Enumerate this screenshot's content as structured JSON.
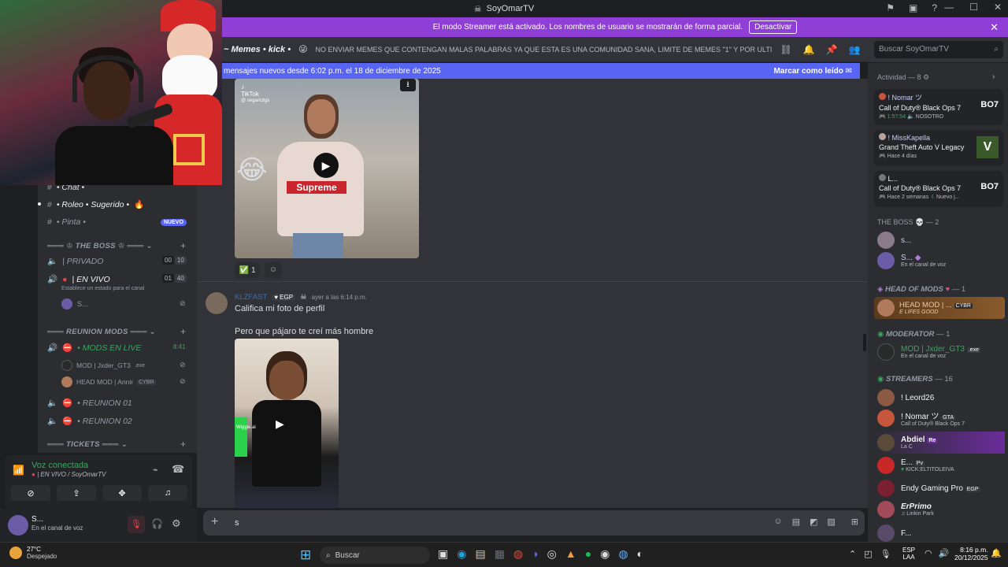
{
  "window": {
    "title": "SoyOmarTV"
  },
  "streamer_bar": {
    "text": "El modo Streamer está activado. Los nombres de usuario se mostrarán de forma parcial.",
    "button": "Desactivar"
  },
  "header": {
    "channel": "Memes • kick •",
    "topic": "NO ENVIAR MEMES QUE CONTENGAN MALAS PALABRAS YA QUE ESTA ES UNA COMUNIDAD SANA, LIMITE DE MEMES \"1\" Y POR ULTIMO E...",
    "search_placeholder": "Buscar SoyOmarTV"
  },
  "newbar": {
    "text": "mensajes nuevos desde 6:02 p.m. el 18 de diciembre de 2025",
    "mark_read": "Marcar como leído"
  },
  "messages": {
    "video_tiktok_label": "TikTok",
    "video_tiktok_user": "@ segaricitgs",
    "reaction_count": "1",
    "msg2": {
      "author": "KLZFAST",
      "tag": "EGP",
      "time": "ayer a las 6:14 p.m.",
      "line1": "Califica mi foto de perfil",
      "line2": "Pero que pájaro te creí más hombre"
    },
    "video2_watermark": "Wiggle.ai"
  },
  "input": {
    "value": "s"
  },
  "channels": {
    "items": [
      {
        "label": "• Chat •"
      },
      {
        "label": "• Roleo • Sugerido •"
      },
      {
        "label": "• Pinta •",
        "badge": "NUEVO"
      }
    ],
    "cat_boss": "THE BOSS",
    "privado": {
      "label": "| PRIVADO",
      "a": "00",
      "b": "10"
    },
    "envivo": {
      "label": "| EN VIVO",
      "a": "01",
      "b": "40",
      "status": "Establece un estado para el canal",
      "user": "S..."
    },
    "cat_reunion": "REUNION MODS",
    "mods_live": {
      "label": "• MODS EN LIVE",
      "time": "8:41"
    },
    "mod_user1": {
      "name": "MOD | Jxder_GT3",
      "tag": ".exe"
    },
    "mod_user2": {
      "name": "HEAD MOD | Annir",
      "tag": "CYBR"
    },
    "reunion01": "• REUNION 01",
    "reunion02": "• REUNION 02",
    "cat_tickets": "TICKETS"
  },
  "voice": {
    "status": "Voz conectada",
    "channel": "| EN VIVO / SoyOmarTV"
  },
  "userbar": {
    "name": "S...",
    "status": "En el canal de voz"
  },
  "members": {
    "activity_header": "Actividad — 8",
    "activities": [
      {
        "user": "! Nomar ツ",
        "game": "Call of Duty® Black Ops 7",
        "detail": "1:57:54",
        "detail2": "NOSOTRO",
        "logo": "BO7"
      },
      {
        "user": "! MissKapella",
        "game": "Grand Theft Auto V Legacy",
        "detail": "Hace 4 días",
        "detail2": "",
        "logo": "V"
      },
      {
        "user": "L...",
        "game": "Call of Duty® Black Ops 7",
        "detail": "Hace 2 semanas",
        "detail2": "Nuevo j...",
        "logo": "BO7"
      }
    ],
    "boss_header": "THE BOSS",
    "boss_count": "— 2",
    "boss_members": [
      {
        "name": "s...",
        "sub": ""
      },
      {
        "name": "S...",
        "sub": "En el canal de voz"
      }
    ],
    "headmods_header": "HEAD OF MODS",
    "headmods_count": "— 1",
    "headmod": {
      "name": "HEAD MOD | ...",
      "tag": "CYBR",
      "sub": "E LIFES GOOD"
    },
    "moderator_header": "MODERATOR",
    "moderator_count": "— 1",
    "moderator": {
      "name": "MOD | Jxder_GT3",
      "tag": ".exe",
      "sub": "En el canal de voz"
    },
    "streamers_header": "STREAMERS",
    "streamers_count": "— 16",
    "streamers": [
      {
        "name": "! Leord26",
        "tag": "",
        "sub": ""
      },
      {
        "name": "! Nomar ツ",
        "tag": "GTA",
        "sub": "Call of Duty® Black Ops 7"
      },
      {
        "name": "Abdiel",
        "tag": "Re",
        "sub": "La C"
      },
      {
        "name": "E...",
        "tag": "Pv",
        "sub": "KICK:ELTITOLEIVA"
      },
      {
        "name": "Endy Gaming Pro",
        "tag": "EGP",
        "sub": ""
      },
      {
        "name": "ErPrimo",
        "tag": "",
        "sub": "Linkin Park"
      },
      {
        "name": "F...",
        "tag": "",
        "sub": ""
      }
    ]
  },
  "taskbar": {
    "weather_temp": "27°C",
    "weather_desc": "Despejado",
    "search": "Buscar",
    "lang1": "ESP",
    "lang2": "LAA",
    "time": "8:16 p.m.",
    "date": "20/12/2025"
  }
}
